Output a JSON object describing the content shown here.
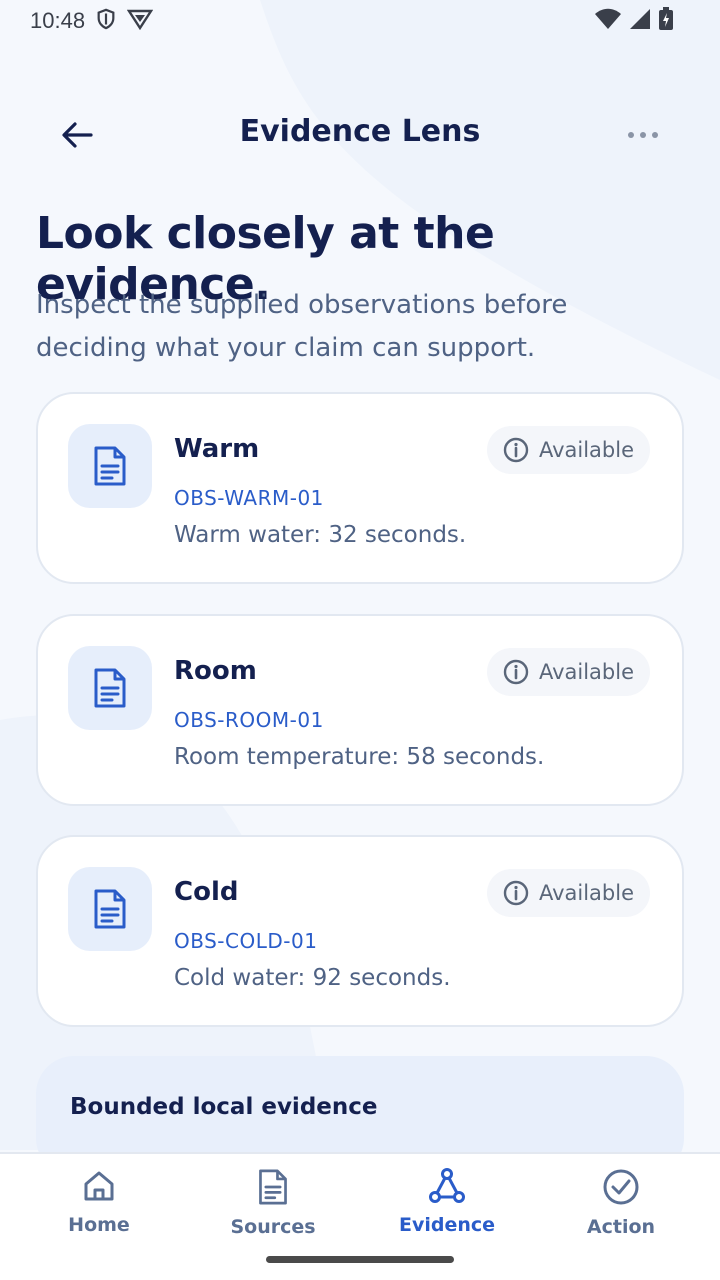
{
  "status_bar": {
    "time": "10:48"
  },
  "app_bar": {
    "title": "Evidence Lens"
  },
  "headline": "Look closely at the evidence.",
  "subtext": "Inspect the supplied observations before deciding what your claim can support.",
  "cards": [
    {
      "title": "Warm",
      "code": "OBS-WARM-01",
      "description": "Warm water: 32 seconds.",
      "badge": "Available"
    },
    {
      "title": "Room",
      "code": "OBS-ROOM-01",
      "description": "Room temperature: 58 seconds.",
      "badge": "Available"
    },
    {
      "title": "Cold",
      "code": "OBS-COLD-01",
      "description": "Cold water: 92 seconds.",
      "badge": "Available"
    }
  ],
  "bounded_section": {
    "title": "Bounded local evidence"
  },
  "nav": [
    {
      "label": "Home",
      "icon": "home-icon",
      "active": false
    },
    {
      "label": "Sources",
      "icon": "document-icon",
      "active": false
    },
    {
      "label": "Evidence",
      "icon": "graph-nodes-icon",
      "active": true
    },
    {
      "label": "Action",
      "icon": "check-circle-icon",
      "active": false
    }
  ],
  "colors": {
    "primary": "#2a5cc9",
    "heading": "#14204f",
    "muted": "#4f6284"
  }
}
